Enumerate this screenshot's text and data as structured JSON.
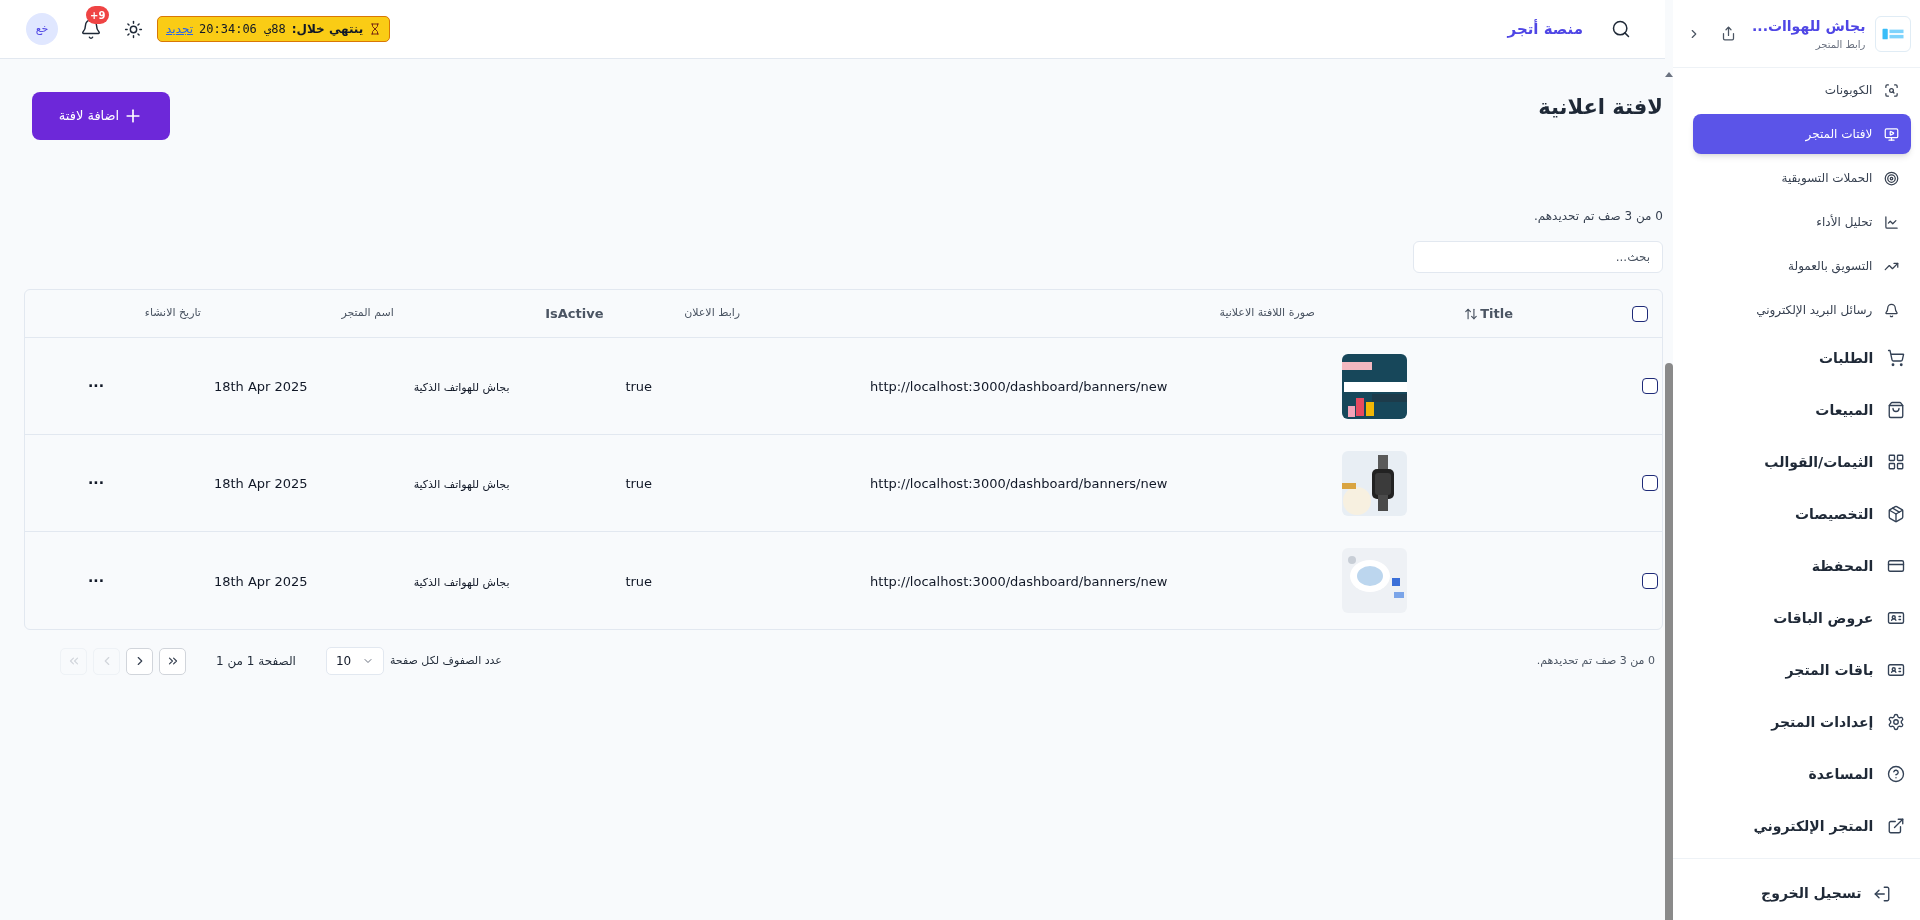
{
  "topbar": {
    "avatar": "خع",
    "notifications": "+9",
    "subscription": {
      "label": "ينتهي خلال:",
      "countdown": "88ي 20:34:06",
      "renew": "تجديد"
    },
    "platform": "منصة أتجر"
  },
  "page": {
    "title": "لافتة اعلانية",
    "add_button": "اضافة لافتة",
    "selection_summary": "0 من 3 صف تم تحديدهم.",
    "search": {
      "placeholder": "بحث..."
    }
  },
  "table": {
    "select_all_checked": false,
    "columns": [
      "Title",
      "صورة اللافتة الاعلانية",
      "رابط الاعلان",
      "IsActive",
      "اسم المتجر",
      "تاريخ الانشاء"
    ],
    "rows": [
      {
        "checked": false,
        "link": "http://localhost:3000/dashboard/banners/new",
        "is_active": "true",
        "store": "بجاش للهواتف الذكية",
        "created": "18th Apr 2025",
        "actions": "···"
      },
      {
        "checked": false,
        "link": "http://localhost:3000/dashboard/banners/new",
        "is_active": "true",
        "store": "بجاش للهواتف الذكية",
        "created": "18th Apr 2025",
        "actions": "···"
      },
      {
        "checked": false,
        "link": "http://localhost:3000/dashboard/banners/new",
        "is_active": "true",
        "store": "بجاش للهواتف الذكية",
        "created": "18th Apr 2025",
        "actions": "···"
      }
    ]
  },
  "footer": {
    "selection_summary": "0 من 3 صف تم تحديدهم.",
    "rows_per_page_label": "عدد الصفوف لكل صفحة",
    "rows_per_page": "10",
    "page_info": "الصفحة 1 من 1",
    "pager": [
      {
        "kind": "first",
        "disabled": true
      },
      {
        "kind": "prev",
        "disabled": true
      },
      {
        "kind": "next",
        "disabled": false
      },
      {
        "kind": "last",
        "disabled": false
      }
    ]
  },
  "sidebar": {
    "store_name": "بجاش للهواات...",
    "store_link": "رابط المتجر",
    "sub_items": [
      {
        "label": "الكوبونات",
        "selected": false
      },
      {
        "label": "لافتات المتجر",
        "selected": true
      },
      {
        "label": "الحملات التسويقية",
        "selected": false
      },
      {
        "label": "تحليل الأداء",
        "selected": false
      },
      {
        "label": "التسويق بالعمولة",
        "selected": false
      },
      {
        "label": "رسائل البريد الإلكتروني",
        "selected": false
      }
    ],
    "items": [
      {
        "label": "الطلبات",
        "selected": false
      },
      {
        "label": "المبيعات",
        "selected": false
      },
      {
        "label": "الثيمات/القوالب",
        "selected": false
      },
      {
        "label": "التخصيصات",
        "selected": false
      },
      {
        "label": "المحفظة",
        "selected": false
      },
      {
        "label": "عروض الباقات",
        "selected": false
      },
      {
        "label": "باقات المتجر",
        "selected": false
      },
      {
        "label": "إعدادات المتجر",
        "selected": false
      },
      {
        "label": "المساعدة",
        "selected": false
      },
      {
        "label": "المتجر الإلكتروني",
        "selected": false
      }
    ],
    "logout": "تسجيل الخروج"
  }
}
